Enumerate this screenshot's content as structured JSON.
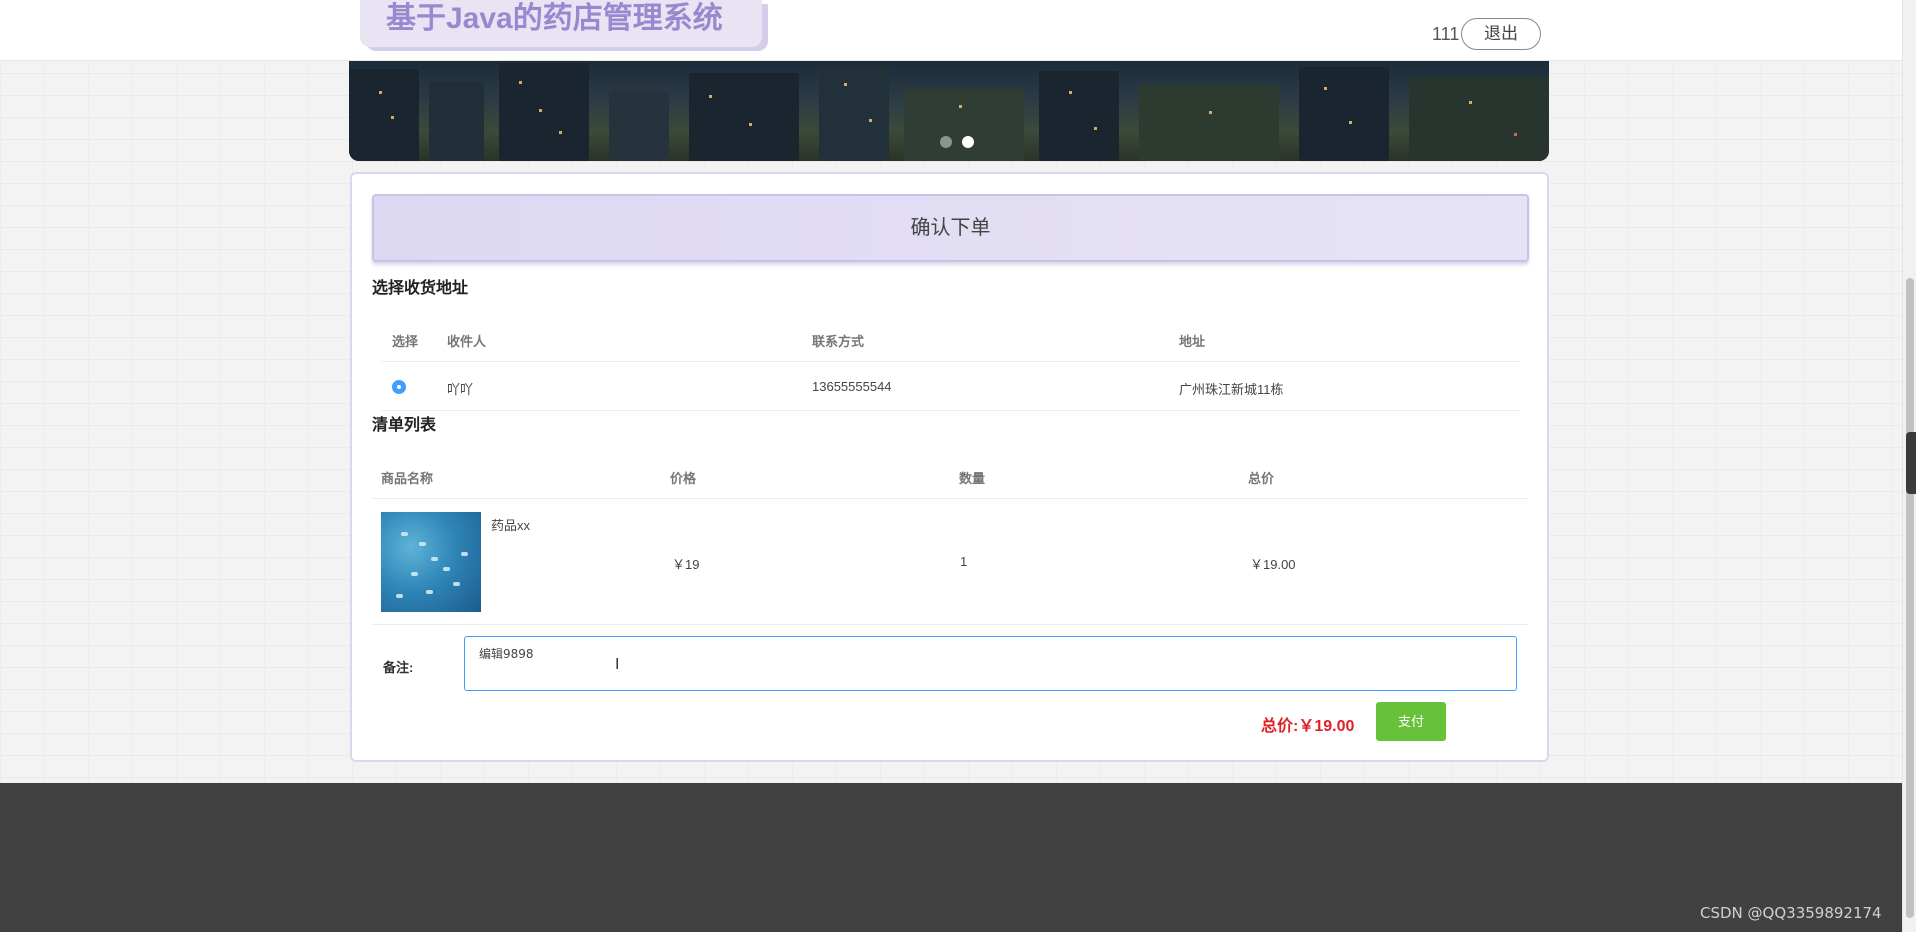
{
  "header": {
    "site_title": "基于Java的药店管理系统",
    "username": "111",
    "logout_label": "退出"
  },
  "banner": {
    "active_slide": 2,
    "slide_count": 2
  },
  "order": {
    "confirm_title": "确认下单",
    "address_section_title": "选择收货地址",
    "address_columns": [
      "选择",
      "收件人",
      "联系方式",
      "地址"
    ],
    "addresses": [
      {
        "selected": true,
        "recipient": "吖吖",
        "phone": "13655555544",
        "address": "广州珠江新城11栋"
      }
    ],
    "list_section_title": "清单列表",
    "item_columns": [
      "商品名称",
      "价格",
      "数量",
      "总价"
    ],
    "items": [
      {
        "name": "药品xx",
        "price": "￥19",
        "quantity": "1",
        "subtotal": "￥19.00"
      }
    ],
    "remark_label": "备注:",
    "remark_value": "编辑9898",
    "total_label": "总价:￥19.00",
    "pay_label": "支付"
  },
  "watermark": "CSDN @QQ3359892174",
  "colors": {
    "accent": "#409eff",
    "title_purple": "#9a88cf",
    "total_red": "#e0212a",
    "pay_green": "#67c23a",
    "footer": "#414141"
  }
}
